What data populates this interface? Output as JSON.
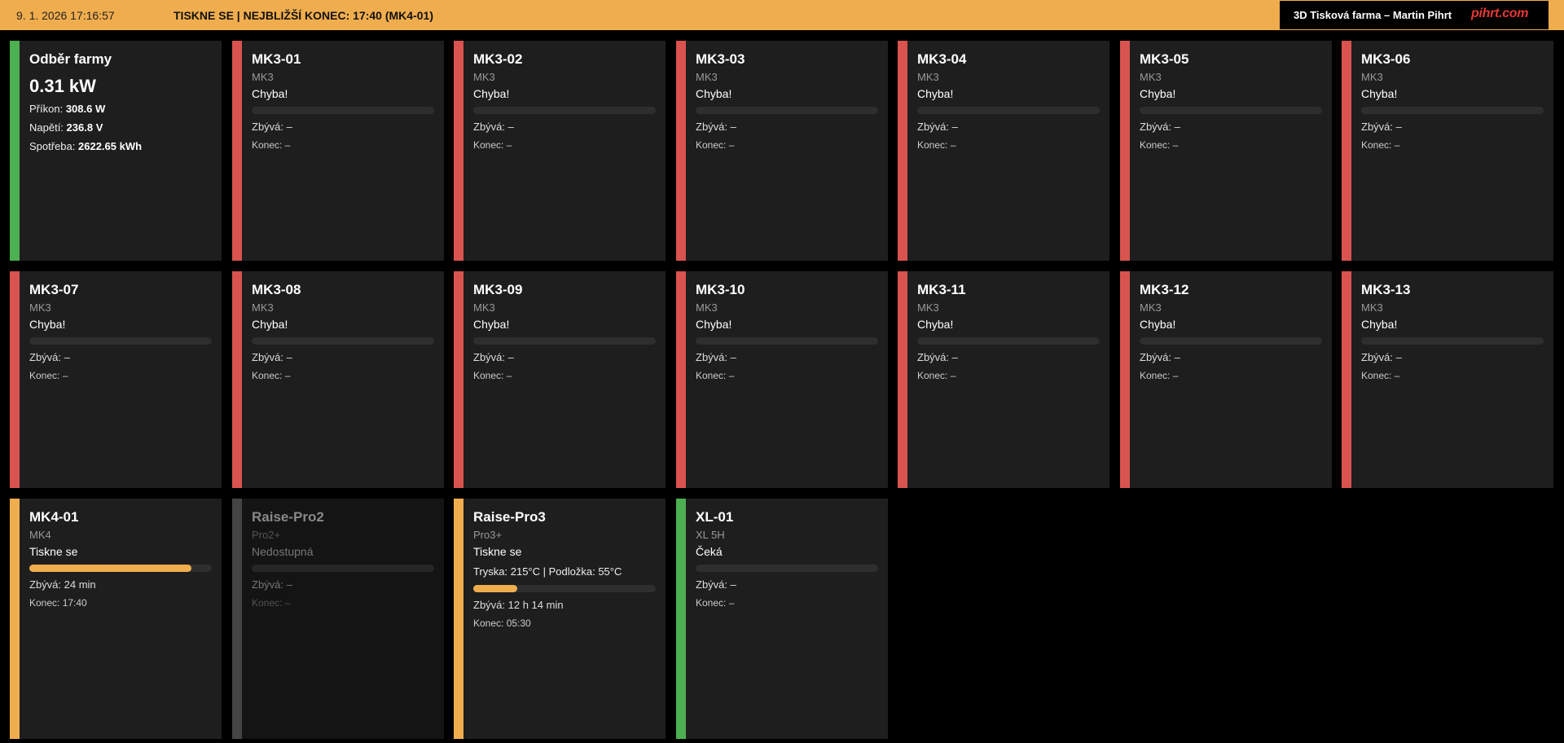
{
  "header": {
    "clock": "9. 1. 2026 17:16:57",
    "status": "TISKNE SE | NEJBLIŽŠÍ KONEC: 17:40 (MK4-01)",
    "brand_title": "3D Tisková farma – Martin Pihrt",
    "brand_logo": "pihrt.com",
    "accent_color": "#f0ad4e"
  },
  "power": {
    "title": "Odběr farmy",
    "total": "0.31 kW",
    "rows": [
      {
        "label": "Příkon:",
        "value": "308.6 W"
      },
      {
        "label": "Napětí:",
        "value": "236.8 V"
      },
      {
        "label": "Spotřeba:",
        "value": "2622.65 kWh"
      }
    ],
    "status_color": "#4caf50"
  },
  "status_colors": {
    "error": "#d9534f",
    "printing": "#f0ad4e",
    "unavailable": "#444444",
    "waiting": "#4caf50"
  },
  "printers": [
    {
      "name": "MK3-01",
      "model": "MK3",
      "state": "Chyba!",
      "remaining_label": "Zbývá:",
      "remaining": "–",
      "end_label": "Konec:",
      "end": "–",
      "status": "error",
      "progress": 0
    },
    {
      "name": "MK3-02",
      "model": "MK3",
      "state": "Chyba!",
      "remaining_label": "Zbývá:",
      "remaining": "–",
      "end_label": "Konec:",
      "end": "–",
      "status": "error",
      "progress": 0
    },
    {
      "name": "MK3-03",
      "model": "MK3",
      "state": "Chyba!",
      "remaining_label": "Zbývá:",
      "remaining": "–",
      "end_label": "Konec:",
      "end": "–",
      "status": "error",
      "progress": 0
    },
    {
      "name": "MK3-04",
      "model": "MK3",
      "state": "Chyba!",
      "remaining_label": "Zbývá:",
      "remaining": "–",
      "end_label": "Konec:",
      "end": "–",
      "status": "error",
      "progress": 0
    },
    {
      "name": "MK3-05",
      "model": "MK3",
      "state": "Chyba!",
      "remaining_label": "Zbývá:",
      "remaining": "–",
      "end_label": "Konec:",
      "end": "–",
      "status": "error",
      "progress": 0
    },
    {
      "name": "MK3-06",
      "model": "MK3",
      "state": "Chyba!",
      "remaining_label": "Zbývá:",
      "remaining": "–",
      "end_label": "Konec:",
      "end": "–",
      "status": "error",
      "progress": 0
    },
    {
      "name": "MK3-07",
      "model": "MK3",
      "state": "Chyba!",
      "remaining_label": "Zbývá:",
      "remaining": "–",
      "end_label": "Konec:",
      "end": "–",
      "status": "error",
      "progress": 0
    },
    {
      "name": "MK3-08",
      "model": "MK3",
      "state": "Chyba!",
      "remaining_label": "Zbývá:",
      "remaining": "–",
      "end_label": "Konec:",
      "end": "–",
      "status": "error",
      "progress": 0
    },
    {
      "name": "MK3-09",
      "model": "MK3",
      "state": "Chyba!",
      "remaining_label": "Zbývá:",
      "remaining": "–",
      "end_label": "Konec:",
      "end": "–",
      "status": "error",
      "progress": 0
    },
    {
      "name": "MK3-10",
      "model": "MK3",
      "state": "Chyba!",
      "remaining_label": "Zbývá:",
      "remaining": "–",
      "end_label": "Konec:",
      "end": "–",
      "status": "error",
      "progress": 0
    },
    {
      "name": "MK3-11",
      "model": "MK3",
      "state": "Chyba!",
      "remaining_label": "Zbývá:",
      "remaining": "–",
      "end_label": "Konec:",
      "end": "–",
      "status": "error",
      "progress": 0
    },
    {
      "name": "MK3-12",
      "model": "MK3",
      "state": "Chyba!",
      "remaining_label": "Zbývá:",
      "remaining": "–",
      "end_label": "Konec:",
      "end": "–",
      "status": "error",
      "progress": 0
    },
    {
      "name": "MK3-13",
      "model": "MK3",
      "state": "Chyba!",
      "remaining_label": "Zbývá:",
      "remaining": "–",
      "end_label": "Konec:",
      "end": "–",
      "status": "error",
      "progress": 0
    },
    {
      "name": "MK4-01",
      "model": "MK4",
      "state": "Tiskne se",
      "remaining_label": "Zbývá:",
      "remaining": "24 min",
      "end_label": "Konec:",
      "end": "17:40",
      "status": "printing",
      "progress": 0.89
    },
    {
      "name": "Raise-Pro2",
      "model": "Pro2+",
      "state": "Nedostupná",
      "remaining_label": "Zbývá:",
      "remaining": "–",
      "end_label": "Konec:",
      "end": "–",
      "status": "unavailable",
      "progress": 0
    },
    {
      "name": "Raise-Pro3",
      "model": "Pro3+",
      "state": "Tiskne se",
      "temps": "Tryska: 215°C  |  Podložka: 55°C",
      "remaining_label": "Zbývá:",
      "remaining": "12 h 14 min",
      "end_label": "Konec:",
      "end": "05:30",
      "status": "printing",
      "progress": 0.24
    },
    {
      "name": "XL-01",
      "model": "XL 5H",
      "state": "Čeká",
      "remaining_label": "Zbývá:",
      "remaining": "–",
      "end_label": "Konec:",
      "end": "–",
      "status": "waiting",
      "progress": 0
    }
  ]
}
